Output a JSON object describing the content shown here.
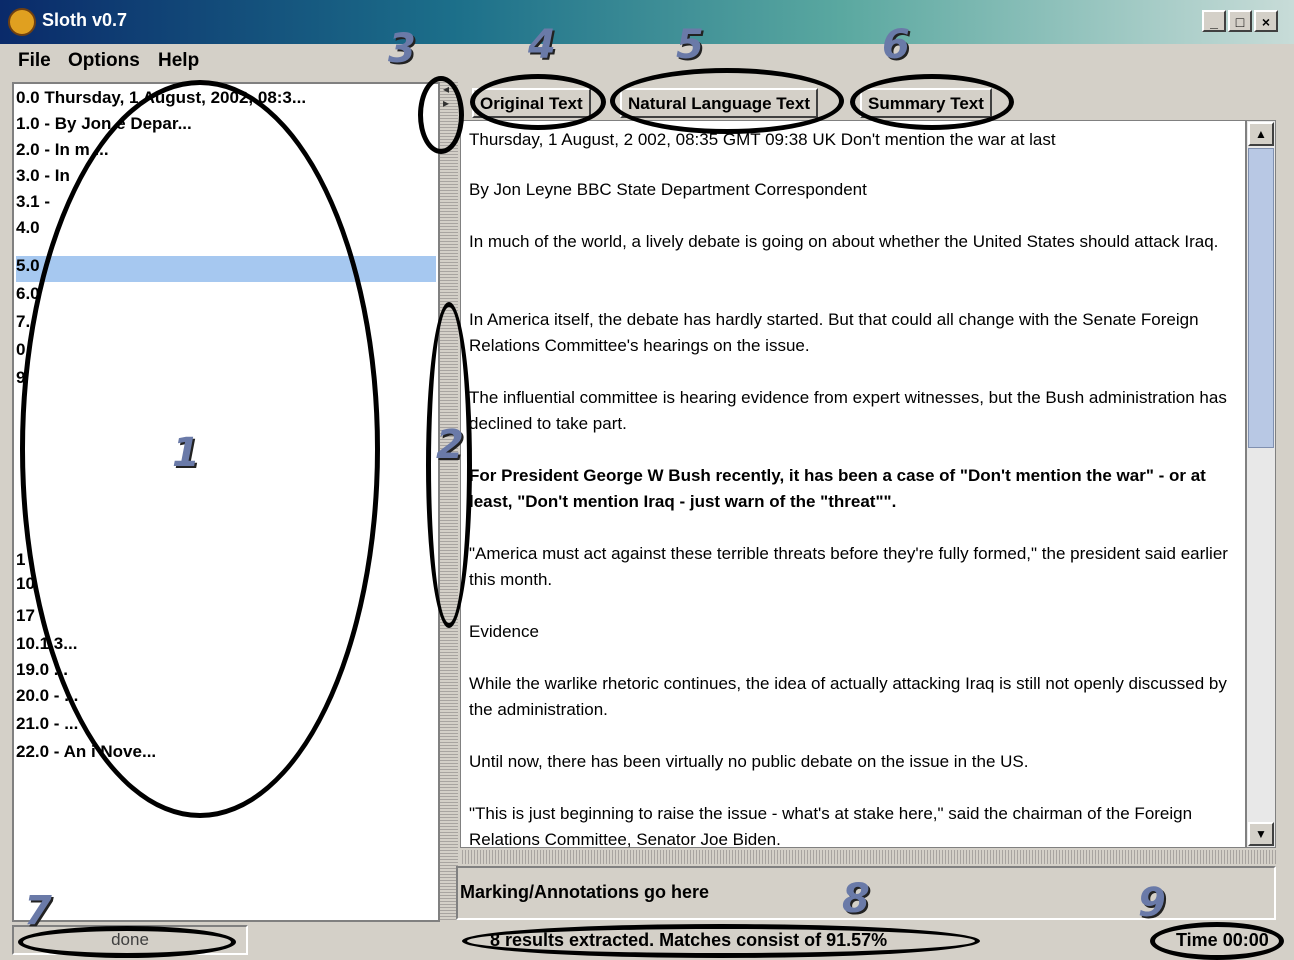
{
  "window": {
    "title": "Sloth v0.7",
    "controls": [
      "_",
      "□",
      "×"
    ]
  },
  "menu": [
    "File",
    "Options",
    "Help"
  ],
  "list": {
    "items": [
      {
        "text": "0.0  Thursday, 1 August, 2002, 08:3..."
      },
      {
        "text": "1.0 - By Jon                   e Depar..."
      },
      {
        "text": "2.0 - In m                         ..."
      },
      {
        "text": "3.0 - In"
      },
      {
        "text": "3.1 - "
      },
      {
        "text": "4.0"
      },
      {
        "text": "5.0",
        "selected": true
      },
      {
        "text": "6.0"
      },
      {
        "text": "7."
      },
      {
        "text": "0"
      },
      {
        "text": "9"
      },
      {
        "text": ""
      },
      {
        "text": ""
      },
      {
        "text": ""
      },
      {
        "text": ""
      },
      {
        "text": ""
      },
      {
        "text": ""
      },
      {
        "text": "1"
      },
      {
        "text": "10"
      },
      {
        "text": "17"
      },
      {
        "text": "10.1                              3..."
      },
      {
        "text": "19.0                              ..."
      },
      {
        "text": "20.0 -                             ..."
      },
      {
        "text": "21.0 -                            ..."
      },
      {
        "text": "22.0 -  An                      i Nove..."
      }
    ]
  },
  "tabs": [
    "Original Text",
    "Natural Language Text",
    "Summary Text"
  ],
  "text_paragraphs": [
    {
      "text": "Thursday, 1 August, 2 002, 08:35 GMT 09:38 UK  Don't mention the war at last",
      "bold": false
    },
    {
      "text": " By Jon Leyne  BBC State Department Correspondent",
      "bold": false
    },
    {
      "text": " In much of the world, a lively debate is going on about whether the United States should attack Iraq.",
      "bold": false
    },
    {
      "text": " In America itself, the debate has hardly started.  But that could all change with the Senate Foreign Relations Committee's hearings on the issue.",
      "bold": false
    },
    {
      "text": " The influential committee is hearing evidence from expert witnesses, but the Bush administration has declined to take part.",
      "bold": false
    },
    {
      "text": " For President George W Bush recently, it has been a case of \"Don't mention the war\" - or at least, \"Don't mention Iraq - just warn of the \"threat\"\".",
      "bold": true
    },
    {
      "text": " \"America must act against these terrible threats before they're fully formed,\" the president said earlier this month.",
      "bold": false
    },
    {
      "text": " Evidence",
      "bold": false
    },
    {
      "text": " While the warlike rhetoric continues, the idea of actually attacking Iraq is still not openly discussed by the administration.",
      "bold": false
    },
    {
      "text": " Until now, there has been virtually no public debate on the issue in the US.",
      "bold": false
    },
    {
      "text": " \"This is just beginning to raise the issue - what's at stake here,\" said the chairman of the Foreign Relations Committee, Senator Joe Biden.",
      "bold": false
    }
  ],
  "annotation_panel": "Marking/Annotations go here",
  "status": {
    "left": "done",
    "middle": "8 results extracted. Matches consist of 91.57%",
    "right": "Time 00:00"
  },
  "callouts": [
    "1",
    "2",
    "3",
    "4",
    "5",
    "6",
    "7",
    "8",
    "9"
  ],
  "icons": {
    "app": "sloth-app-icon",
    "split_left": "◂",
    "split_right": "▸",
    "scroll_up": "▲",
    "scroll_down": "▼"
  }
}
